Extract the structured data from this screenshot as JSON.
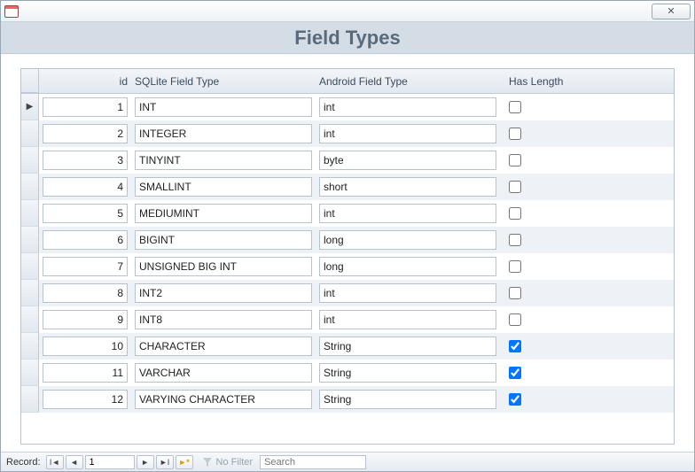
{
  "window": {
    "close_glyph": "✕"
  },
  "form": {
    "title": "Field Types"
  },
  "columns": {
    "id": "id",
    "sqlite": "SQLite Field Type",
    "android": "Android Field Type",
    "has_length": "Has Length"
  },
  "rows": [
    {
      "id": "1",
      "sqlite": "INT",
      "android": "int",
      "has_length": false
    },
    {
      "id": "2",
      "sqlite": "INTEGER",
      "android": "int",
      "has_length": false
    },
    {
      "id": "3",
      "sqlite": "TINYINT",
      "android": "byte",
      "has_length": false
    },
    {
      "id": "4",
      "sqlite": "SMALLINT",
      "android": "short",
      "has_length": false
    },
    {
      "id": "5",
      "sqlite": "MEDIUMINT",
      "android": "int",
      "has_length": false
    },
    {
      "id": "6",
      "sqlite": "BIGINT",
      "android": "long",
      "has_length": false
    },
    {
      "id": "7",
      "sqlite": "UNSIGNED BIG INT",
      "android": "long",
      "has_length": false
    },
    {
      "id": "8",
      "sqlite": "INT2",
      "android": "int",
      "has_length": false
    },
    {
      "id": "9",
      "sqlite": "INT8",
      "android": "int",
      "has_length": false
    },
    {
      "id": "10",
      "sqlite": "CHARACTER",
      "android": "String",
      "has_length": true
    },
    {
      "id": "11",
      "sqlite": "VARCHAR",
      "android": "String",
      "has_length": true
    },
    {
      "id": "12",
      "sqlite": "VARYING CHARACTER",
      "android": "String",
      "has_length": true
    }
  ],
  "recnav": {
    "label": "Record:",
    "current": "1",
    "first_glyph": "I◄",
    "prev_glyph": "◄",
    "next_glyph": "►",
    "last_glyph": "►I",
    "new_glyph": "►*",
    "filter_label": "No Filter",
    "search_placeholder": "Search"
  }
}
